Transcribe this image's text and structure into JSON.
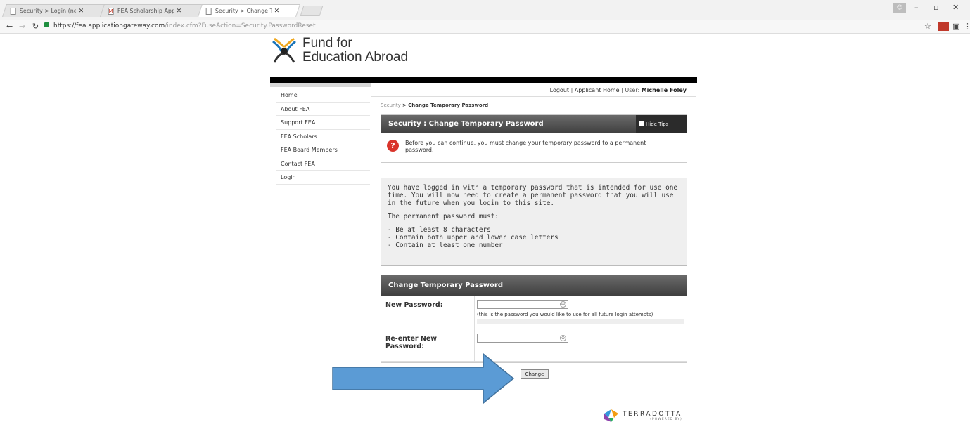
{
  "browser": {
    "tabs": [
      {
        "title": "Security > Login (new u",
        "icon": "page-icon",
        "active": false
      },
      {
        "title": "FEA Scholarship Applica",
        "icon": "gmail-icon",
        "active": false
      },
      {
        "title": "Security > Change Temp",
        "icon": "page-icon",
        "active": true
      }
    ],
    "url_host": "https://fea.applicationgateway.com",
    "url_path": "/index.cfm?FuseAction=Security.PasswordReset"
  },
  "site": {
    "logo_line1": "Fund for",
    "logo_line2": "Education Abroad"
  },
  "sidebar": {
    "items": [
      {
        "label": "Home"
      },
      {
        "label": "About FEA"
      },
      {
        "label": "Support FEA"
      },
      {
        "label": "FEA Scholars"
      },
      {
        "label": "FEA Board Members"
      },
      {
        "label": "Contact FEA"
      },
      {
        "label": "Login"
      }
    ]
  },
  "userbar": {
    "logout": "Logout",
    "separator": "|",
    "home": "Applicant Home",
    "user_label": "User:",
    "user_name": "Michelle Foley"
  },
  "breadcrumb": {
    "link": "Security",
    "separator": ">",
    "current": "Change Temporary Password"
  },
  "notice_panel": {
    "title": "Security : Change Temporary Password",
    "tips_label": "Hide Tips",
    "message": "Before you can continue, you must change your temporary password to a permanent password."
  },
  "info": {
    "para1": "You have logged in with a temporary password that is intended for use one time. You will now need to create a permanent password that you will use in the future when you login to this site.",
    "para2": "The permanent password must:",
    "rules": [
      "- Be at least 8 characters",
      "- Contain both upper and lower case letters",
      "- Contain at least one number"
    ]
  },
  "form": {
    "title": "Change Temporary Password",
    "new_password_label": "New Password:",
    "new_password_value": "",
    "hint": "(this is the password you would like to use for all future login attempts)",
    "reenter_label": "Re-enter New Password:",
    "reenter_value": "",
    "submit_label": "Change"
  },
  "footer": {
    "brand": "TERRADOTTA",
    "sub": "(POWERED BY)"
  },
  "colors": {
    "arrow_fill": "#5b9bd5",
    "arrow_stroke": "#41719c",
    "panel_header": "#4a4a4a",
    "error_icon": "#d9342b"
  }
}
